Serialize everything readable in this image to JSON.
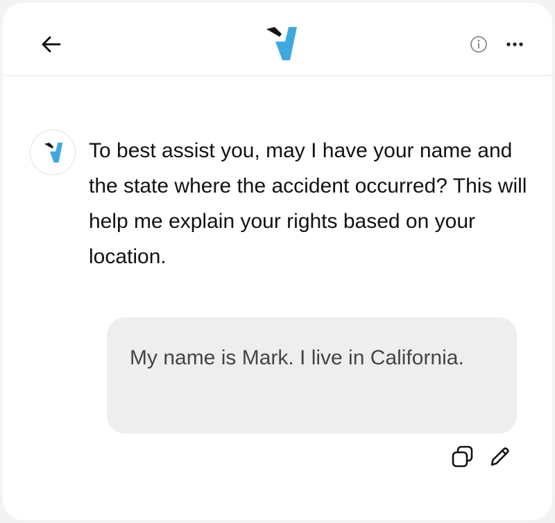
{
  "header": {
    "back_icon": "arrow-left-icon",
    "logo_icon": "v-logo-icon",
    "info_icon": "info-circle-icon",
    "more_icon": "ellipsis-horizontal-icon"
  },
  "colors": {
    "brand_blue": "#3fa9df",
    "brand_dark": "#111111",
    "bubble_background": "#eeeeee"
  },
  "conversation": {
    "assistant": {
      "avatar_icon": "v-logo-icon",
      "text": "To best assist you, may I have your name and the state where the accident occurred? This will help me explain your rights based on your location."
    },
    "user": {
      "text": "My name is Mark. I live in California.",
      "actions": [
        {
          "icon": "copy-icon"
        },
        {
          "icon": "pencil-edit-icon"
        }
      ]
    }
  }
}
